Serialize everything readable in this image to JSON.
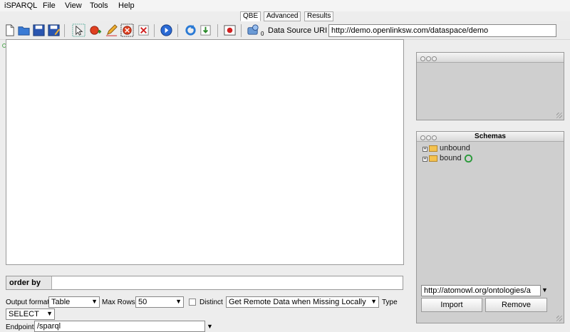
{
  "app": {
    "title": "iSPARQL"
  },
  "menu": [
    "File",
    "View",
    "Tools",
    "Help"
  ],
  "tabs": [
    {
      "label": "QBE",
      "active": true
    },
    {
      "label": "Advanced",
      "active": false
    },
    {
      "label": "Results",
      "active": false
    }
  ],
  "toolbar": {
    "icons": [
      "new-icon",
      "open-icon",
      "save-icon",
      "save-as-icon",
      "select-icon",
      "add-node-icon",
      "edit-icon",
      "clear-icon",
      "delete-icon",
      "run-icon",
      "refresh-icon",
      "import-icon",
      "link-icon",
      "datasource-icon"
    ],
    "datasource_index": "0",
    "datasource_label": "Data Source URI",
    "datasource_uri": "http://demo.openlinksw.com/dataspace/demo"
  },
  "orderby": {
    "label": "order by"
  },
  "options": {
    "output_format_label": "Output format",
    "output_format": "Table",
    "max_rows_label": "Max Rows",
    "max_rows": "50",
    "distinct_label": "Distinct",
    "remote_data": "Get Remote Data when Missing Locally",
    "type_label": "Type",
    "type": "SELECT",
    "endpoint_label": "Endpoint",
    "endpoint": "/sparql"
  },
  "schemas": {
    "title": "Schemas",
    "items": [
      {
        "label": "unbound"
      },
      {
        "label": "bound"
      }
    ],
    "import_uri": "http://atomowl.org/ontologies/a",
    "import_label": "Import",
    "remove_label": "Remove"
  }
}
